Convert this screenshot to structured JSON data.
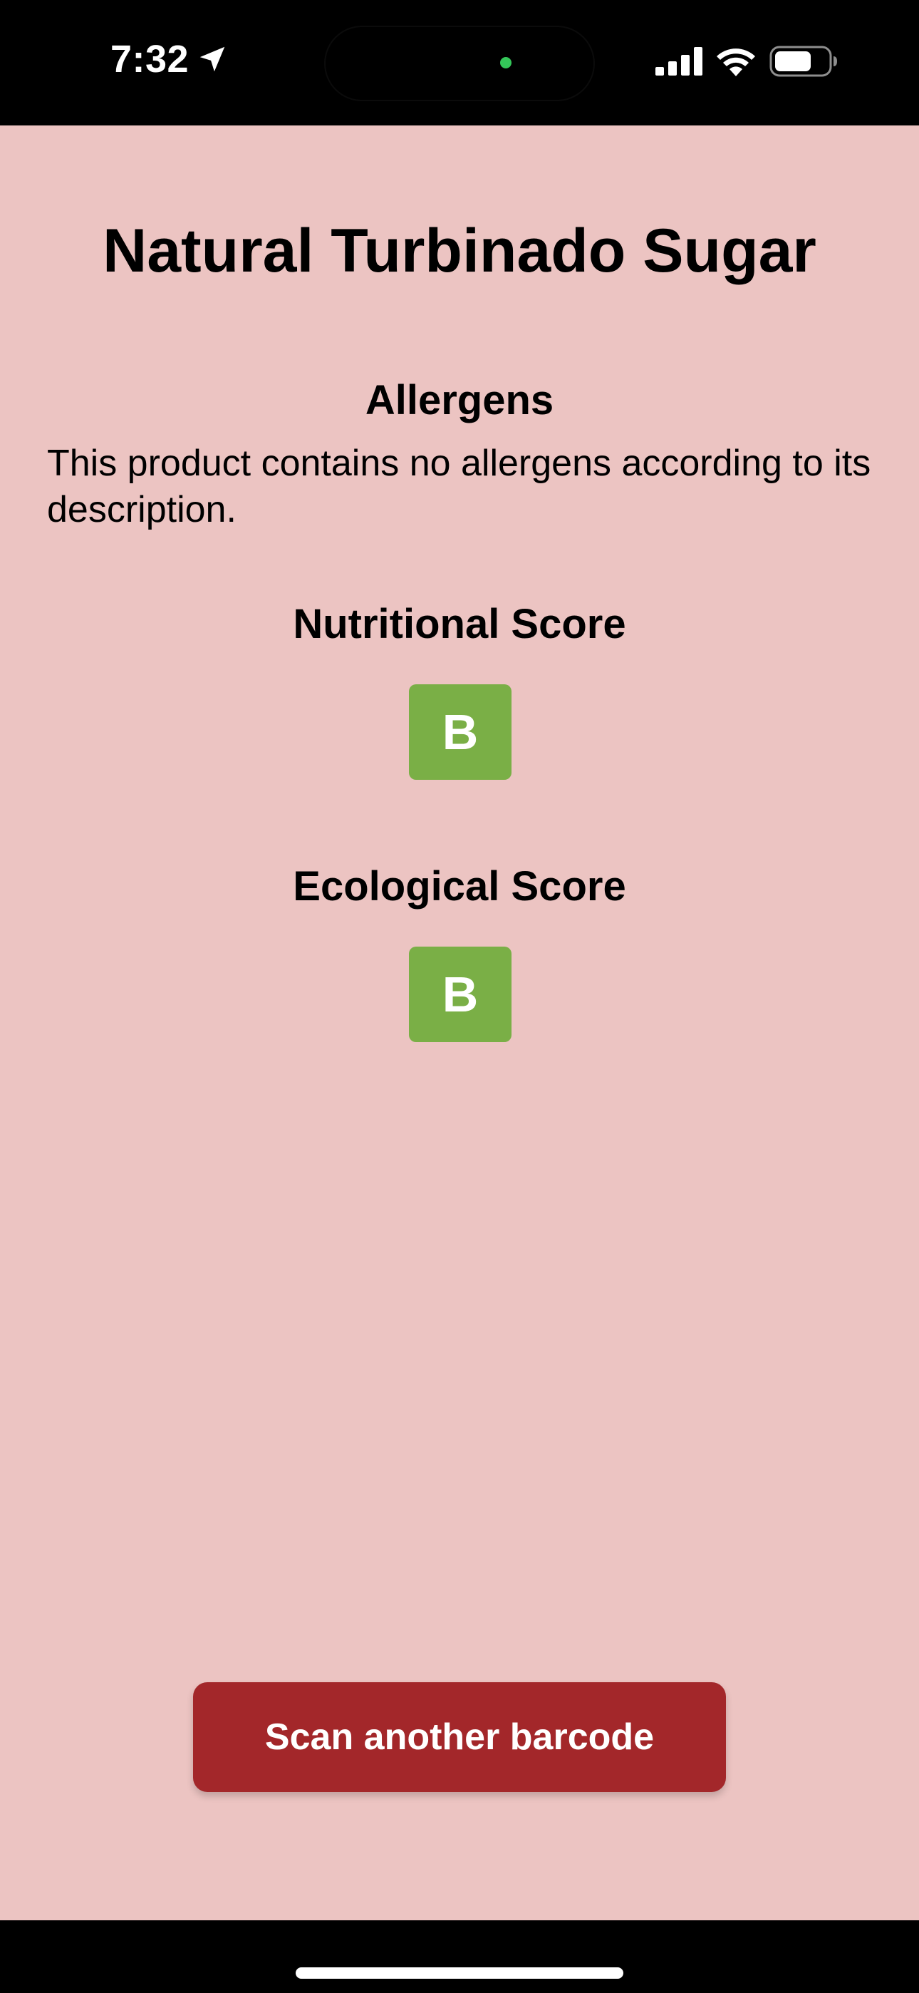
{
  "status_bar": {
    "time": "7:32",
    "icons": [
      "location-arrow-icon",
      "cellular-signal-icon",
      "wifi-icon",
      "battery-icon"
    ],
    "privacy_indicator_color": "#34c759"
  },
  "product": {
    "name": "Natural Turbinado Sugar"
  },
  "allergens": {
    "heading": "Allergens",
    "text": "This product contains no allergens according to its description."
  },
  "nutritional_score": {
    "heading": "Nutritional Score",
    "grade": "B",
    "color": "#7aaf46"
  },
  "ecological_score": {
    "heading": "Ecological Score",
    "grade": "B",
    "color": "#7aaf46"
  },
  "actions": {
    "scan_label": "Scan another barcode",
    "scan_color": "#a3272a"
  },
  "colors": {
    "background": "#ecc4c2",
    "system_bars": "#000000"
  }
}
